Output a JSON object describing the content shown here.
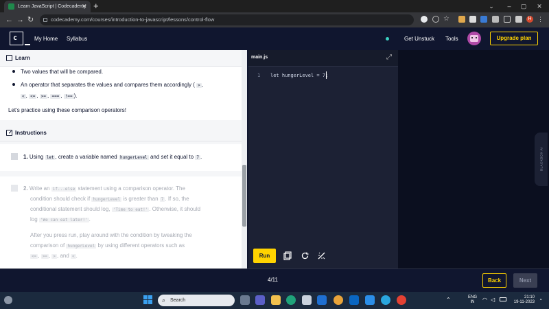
{
  "browser": {
    "tab_title": "Learn JavaScript | Codecademy",
    "tab_close": "✕",
    "new_tab": "+",
    "url": "codecademy.com/courses/introduction-to-javascript/lessons/control-flow",
    "win_min": "–",
    "win_max": "▢",
    "win_close": "✕",
    "chevron": "⌄",
    "back": "←",
    "forward": "→",
    "reload": "↻",
    "profile_letter": "H"
  },
  "header": {
    "my_home": "My Home",
    "syllabus": "Syllabus",
    "get_unstuck": "Get Unstuck",
    "tools": "Tools",
    "upgrade": "Upgrade plan"
  },
  "learn": {
    "heading": "Learn",
    "bullet1": "Two values that will be compared.",
    "bullet2_a": "An operator that separates the values and compares them accordingly (",
    "ops": [
      ">",
      "<",
      "<=",
      ">=",
      "===",
      "!=="
    ],
    "bullet2_end": ").",
    "practice": "Let’s practice using these comparison operators!"
  },
  "instructions": {
    "heading": "Instructions",
    "step1_num": "1.",
    "step1_a": "Using",
    "step1_code1": "let",
    "step1_b": ", create a variable named",
    "step1_code2": "hungerLevel",
    "step1_c": "and set it equal to",
    "step1_code3": "7",
    "step1_d": ".",
    "step2_num": "2.",
    "step2_l1a": "Write an",
    "step2_l1code": "if...else",
    "step2_l1b": "statement using a comparison operator. The",
    "step2_l2a": "condition should check if",
    "step2_l2code": "hungerLevel",
    "step2_l2b": "is greater than",
    "step2_l2code2": "7",
    "step2_l2c": ". If so, the",
    "step2_l3a": "conditional statement should log,",
    "step2_l3code": "'Time to eat!'",
    "step2_l3b": ". Otherwise, it should",
    "step2_l4a": "log",
    "step2_l4code": "'We can eat later!'",
    "step2_l4b": ".",
    "step2_p2_l1": "After you press run, play around with the condition by tweaking the",
    "step2_p2_l2a": "comparison of",
    "step2_p2_l2code": "hungerLevel",
    "step2_p2_l2b": "by using different operators such as",
    "step2_p2_l3_ops": [
      "<=",
      ">=",
      ">"
    ],
    "step2_p2_l3_and": ", and",
    "step2_p2_l3_last": "<",
    "step2_p2_l3_end": "."
  },
  "editor": {
    "filename": "main.js",
    "expand_icon": "⤢",
    "line_number": "1",
    "code": "let hungerLevel = 7;",
    "run": "Run",
    "sidebar_label": "BLACKBOX AI"
  },
  "footer": {
    "progress": "4/11",
    "back": "Back",
    "next": "Next"
  },
  "taskbar": {
    "search": "Search",
    "lang1": "ENG",
    "lang2": "IN",
    "time": "21:10",
    "date": "19-11-2023"
  }
}
